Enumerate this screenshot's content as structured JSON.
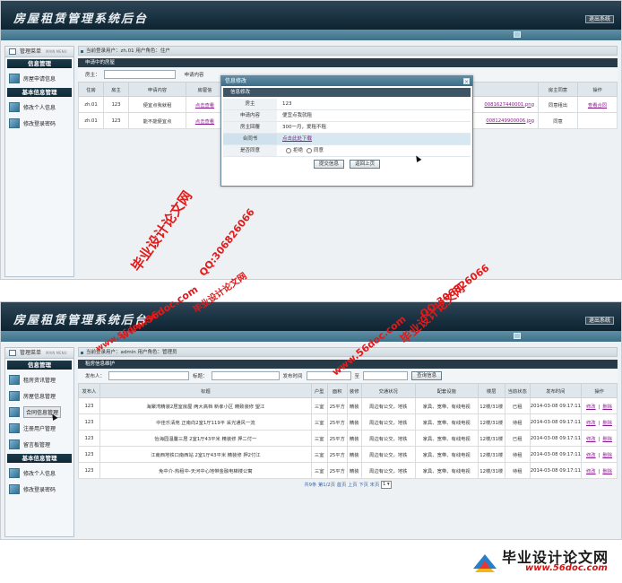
{
  "app": {
    "title": "房屋租赁管理系统后台",
    "exit_label": "退出系统"
  },
  "screen1": {
    "sidebar": {
      "header": "管理菜单",
      "header_small": "MAIN MENU",
      "group1": "信息管理",
      "items1": [
        "房屋申请信息"
      ],
      "group2": "基本信息管理",
      "items2": [
        "修改个人信息",
        "修改登录密码"
      ]
    },
    "infobar": "当前登录用户：zh.01  用户角色：住户",
    "section": "申请中的房屋",
    "filter": {
      "label1": "房主：",
      "label2": "申请内容"
    },
    "table": {
      "headers": [
        "住房",
        "房主",
        "申请内容",
        "房屋信",
        "合同书",
        "房主同意",
        "操作"
      ],
      "rows": [
        [
          "zh.01",
          "123",
          "便宜点我就租",
          "点击查看",
          "0081627440001.png",
          "同意租出",
          "查看合同"
        ],
        [
          "zh.01",
          "123",
          "能不能便宜点",
          "点击查看",
          "0081249900006.jpg",
          "同意",
          ""
        ]
      ]
    },
    "modal": {
      "title": "信息修改",
      "close": "×",
      "section": "信息修改",
      "rows": [
        {
          "k": "房主",
          "v": "123"
        },
        {
          "k": "申请内容",
          "v": "便宜点我就租"
        },
        {
          "k": "房主回覆",
          "v": "300一月，爱租不租"
        },
        {
          "k": "合同书",
          "v": "点击此处下载"
        },
        {
          "k": "是否同意",
          "v1": "拒绝",
          "v2": "同意"
        }
      ],
      "btn_submit": "提交信息",
      "btn_back": "返回上页"
    }
  },
  "screen2": {
    "sidebar": {
      "header": "管理菜单",
      "header_small": "MAIN MENU",
      "group1": "信息管理",
      "items1": [
        "租房资讯管理",
        "房屋信息管理",
        "合同信息管理",
        "注册用户管理",
        "留言板管理"
      ],
      "group2": "基本信息管理",
      "items2": [
        "修改个人信息",
        "修改登录密码"
      ]
    },
    "infobar": "当前登录用户：admin  用户角色：管理员",
    "section": "租房信息维护",
    "filter": {
      "l1": "发布人：",
      "l2": "标题：",
      "l3": "发布时间",
      "l4": "至",
      "btn": "查询信息"
    },
    "table": {
      "headers": [
        "发布人",
        "标题",
        "户型",
        "面积",
        "装修",
        "交通状况",
        "配套设施",
        "楼层",
        "当前状态",
        "发布时间",
        "操作"
      ],
      "rows": [
        [
          "123",
          "海聚湾精装2居室房屋 两大高档 新孝小区 精致装修 望江",
          "三室",
          "25平方",
          "精装",
          "周边有公交，地铁",
          "家具、宽带、有线电视",
          "12楼/31楼",
          "已租",
          "2014-03-08 09:17:11"
        ],
        [
          "123",
          "中佳乐清苑 正南向2室1厅119平 采光通风一流",
          "三室",
          "25平方",
          "精装",
          "周边有公交，地铁",
          "家具、宽带、有线电视",
          "12楼/31楼",
          "待租",
          "2014-03-08 09:17:11"
        ],
        [
          "123",
          "怡海园温馨三居 2室1厅43平米 精装修 押二付一",
          "三室",
          "25平方",
          "精装",
          "周边有公交，地铁",
          "家具、宽带、有线电视",
          "12楼/31楼",
          "已租",
          "2014-03-08 09:17:11"
        ],
        [
          "123",
          "江南西地铁口南西站 2室1厅43平米 精装修 押2付江",
          "三室",
          "25平方",
          "精装",
          "周边有公交，地铁",
          "家具、宽带、有线电视",
          "12楼/31楼",
          "待租",
          "2014-03-08 09:17:11"
        ],
        [
          "123",
          "免中介-热租中-天河中心地带金融电梯楼公寓",
          "三室",
          "25平方",
          "精装",
          "周边有公交，地铁",
          "家具、宽带、有线电视",
          "12楼/31楼",
          "待租",
          "2014-03-08 09:17:11"
        ]
      ],
      "op_edit": "修改",
      "op_sep": "|",
      "op_delete": "删除"
    },
    "pager": {
      "total": "共9条",
      "page": "第1/2页",
      "first": "首页",
      "prev": "上页",
      "next": "下页",
      "last": "末页",
      "select": "1"
    }
  },
  "watermarks": [
    "毕业设计论文网",
    "QQ:306826066",
    "www.56doc.com",
    "QQ:306826066",
    "毕业设计论文网",
    "www.56doc.com",
    "www.56doc.com",
    "毕业设计论文网"
  ],
  "brand": {
    "title": "毕业设计论文网",
    "url": "www.56doc.com"
  }
}
